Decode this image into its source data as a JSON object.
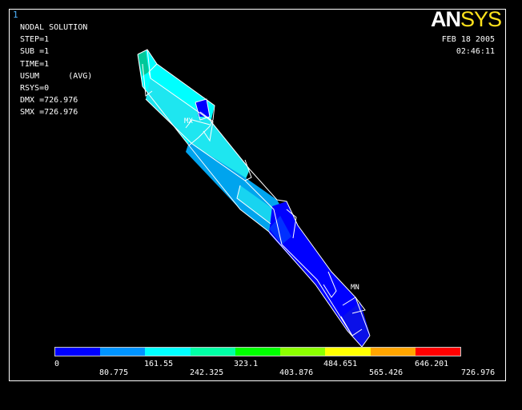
{
  "window_number": "1",
  "info_lines": [
    "NODAL SOLUTION",
    "STEP=1",
    "SUB =1",
    "TIME=1",
    "USUM      (AVG)",
    "RSYS=0",
    "DMX =726.976",
    "SMX =726.976"
  ],
  "logo": {
    "part1": "AN",
    "part2": "SYS"
  },
  "date": "FEB 18 2005",
  "time": "02:46:11",
  "markers": {
    "max": "MX",
    "min": "MN"
  },
  "legend": {
    "colors": [
      "#0000ff",
      "#0094ff",
      "#00ffff",
      "#00ffa5",
      "#00ff00",
      "#8cff00",
      "#ffff00",
      "#ffa500",
      "#ff0000"
    ],
    "labels_top": [
      "0",
      "161.55",
      "323.1",
      "484.651",
      "646.201"
    ],
    "labels_bottom": [
      "80.775",
      "242.325",
      "403.876",
      "565.426",
      "726.976"
    ]
  }
}
